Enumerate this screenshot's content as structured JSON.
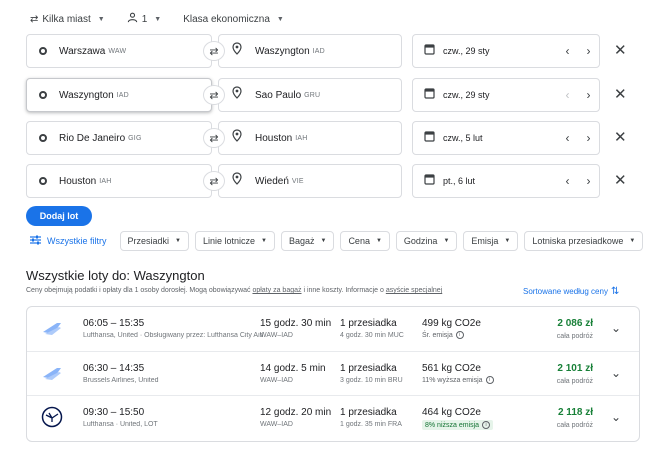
{
  "options": {
    "trip_type": "Kilka miast",
    "passengers": "1",
    "cabin": "Klasa ekonomiczna"
  },
  "legs": [
    {
      "from_city": "Warszawa",
      "from_code": "WAW",
      "to_city": "Waszyngton",
      "to_code": "IAD",
      "date": "czw., 29 sty"
    },
    {
      "from_city": "Waszyngton",
      "from_code": "IAD",
      "to_city": "Sao Paulo",
      "to_code": "GRU",
      "date": "czw., 29 sty"
    },
    {
      "from_city": "Rio De Janeiro",
      "from_code": "GIG",
      "to_city": "Houston",
      "to_code": "IAH",
      "date": "czw., 5 lut"
    },
    {
      "from_city": "Houston",
      "from_code": "IAH",
      "to_city": "Wiedeń",
      "to_code": "VIE",
      "date": "pt., 6 lut"
    }
  ],
  "add_flight_label": "Dodaj lot",
  "filters": {
    "all_label": "Wszystkie filtry",
    "chips": [
      "Przesiadki",
      "Linie lotnicze",
      "Bagaż",
      "Cena",
      "Godzina",
      "Emisja",
      "Lotniska przesiadkowe"
    ]
  },
  "results": {
    "title": "Wszystkie loty do: Waszyngton",
    "note_prefix": "Ceny obejmują podatki i opłaty dla 1 osoby dorosłej. Mogą obowiązywać ",
    "note_link1": "opłaty za bagaż",
    "note_mid": " i inne koszty. Informacje o ",
    "note_link2": "asyście specjalnej",
    "sort_label": "Sortowane według ceny",
    "flights": [
      {
        "times": "06:05 – 15:35",
        "airline": "Lufthansa, United · Obsługiwany przez: Lufthansa City Airlines",
        "duration": "15 godz. 30 min",
        "route": "WAW–IAD",
        "stops": "1 przesiadka",
        "stop_info": "4 godz. 30 min MUC",
        "co2": "499 kg CO2e",
        "emission": "Śr. emisja",
        "price": "2 086 zł",
        "price_note": "cała podróż"
      },
      {
        "times": "06:30 – 14:35",
        "airline": "Brussels Airlines, United",
        "duration": "14 godz. 5 min",
        "route": "WAW–IAD",
        "stops": "1 przesiadka",
        "stop_info": "3 godz. 10 min BRU",
        "co2": "561 kg CO2e",
        "emission": "11% wyższa emisja",
        "price": "2 101 zł",
        "price_note": "cała podróż"
      },
      {
        "times": "09:30 – 15:50",
        "airline": "Lufthansa · United, LOT",
        "duration": "12 godz. 20 min",
        "route": "WAW–IAD",
        "stops": "1 przesiadka",
        "stop_info": "1 godz. 35 min FRA",
        "co2": "464 kg CO2e",
        "emission": "8% niższa emisja",
        "price": "2 118 zł",
        "price_note": "cała podróż"
      }
    ]
  },
  "colors": {
    "accent": "#1a73e8",
    "price": "#188038",
    "green_badge_bg": "#e6f4ea",
    "tail_blue": "#8ab4f8",
    "lufthansa_navy": "#05164d"
  }
}
